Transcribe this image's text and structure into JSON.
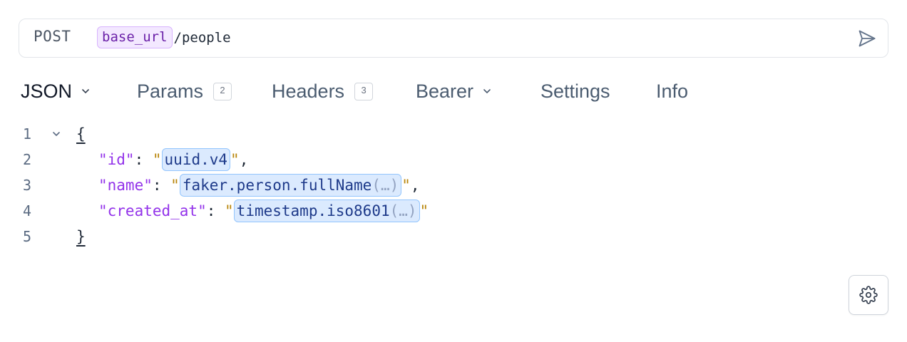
{
  "request": {
    "method": "POST",
    "url_variable": "base_url",
    "url_path": "/people"
  },
  "tabs": [
    {
      "label": "JSON",
      "active": true,
      "has_dropdown": true
    },
    {
      "label": "Params",
      "count": "2"
    },
    {
      "label": "Headers",
      "count": "3"
    },
    {
      "label": "Bearer",
      "has_dropdown": true
    },
    {
      "label": "Settings"
    },
    {
      "label": "Info"
    }
  ],
  "editor": {
    "line_numbers": [
      "1",
      "2",
      "3",
      "4",
      "5"
    ],
    "open_brace": "{",
    "close_brace": "}",
    "fields": [
      {
        "key": "\"id\"",
        "template": "uuid.v4",
        "has_args": false,
        "trailing_comma": ","
      },
      {
        "key": "\"name\"",
        "template": "faker.person.fullName",
        "has_args": true,
        "trailing_comma": ","
      },
      {
        "key": "\"created_at\"",
        "template": "timestamp.iso8601",
        "has_args": true,
        "trailing_comma": ""
      }
    ],
    "args_placeholder": "(…)"
  },
  "icons": {
    "send": "send-icon",
    "settings": "gear-icon",
    "dropdown": "chevron-down-icon",
    "fold": "chevron-down-icon"
  },
  "colors": {
    "variable_chip_bg": "#f3e8ff",
    "variable_chip_text": "#6b21a8",
    "json_key": "#9333ea",
    "template_chip_bg": "#dbeafe",
    "template_chip_text": "#1e3a8a",
    "string_quote": "#b8860b"
  }
}
